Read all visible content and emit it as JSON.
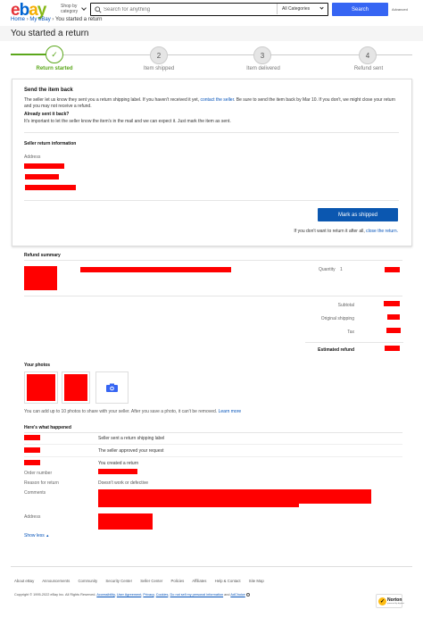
{
  "header": {
    "logo_letters": [
      "e",
      "b",
      "a",
      "y"
    ],
    "logo_colors": [
      "#e53238",
      "#0064d2",
      "#f5af02",
      "#86b817"
    ],
    "shop_by_line1": "Shop by",
    "shop_by_line2": "category",
    "search_placeholder": "Search for anything",
    "category_select": "All Categories",
    "search_button": "Search",
    "advanced_link": "Advanced"
  },
  "breadcrumb": {
    "items": [
      "Home",
      "My eBay",
      "You started a return"
    ],
    "separator": "›"
  },
  "page_title": "You started a return",
  "progress": {
    "steps": [
      {
        "label": "Return started",
        "number": "",
        "active": true
      },
      {
        "label": "Item shipped",
        "number": "2",
        "active": false
      },
      {
        "label": "Item delivered",
        "number": "3",
        "active": false
      },
      {
        "label": "Refund sent",
        "number": "4",
        "active": false
      }
    ],
    "active_color": "#5ba71b"
  },
  "send_back": {
    "heading": "Send the item back",
    "body_before_link": "The seller let us know they sent you a return shipping label. If you haven't received it yet,",
    "contact_link": "contact the seller",
    "body_after_link": ". Be sure to send the item back by Mar 10. If you don't, we might close your return and you may not receive a refund.",
    "already_sent_heading": "Already sent it back?",
    "already_sent_body": "It's important to let the seller know the item's in the mail and we can expect it. Just mark the item as sent.",
    "seller_info_heading": "Seller return information",
    "address_label": "Address",
    "mark_shipped_button": "Mark as shipped",
    "dont_return_text": "If you don't want to return it after all,",
    "close_return_link": "close the return."
  },
  "refund_summary": {
    "heading": "Refund summary",
    "quantity_label": "Quantity",
    "quantity_value": "1",
    "subtotal_label": "Subtotal",
    "original_shipping_label": "Original shipping",
    "tax_label": "Tax",
    "estimated_refund_label": "Estimated refund"
  },
  "photos": {
    "heading": "Your photos",
    "note": "You can add up to 10 photos to share with your seller. After you save a photo, it can't be removed.",
    "learn_more": "Learn more"
  },
  "history": {
    "heading": "Here's what happened",
    "events": [
      "Seller sent a return shipping label",
      "The seller approved your request",
      "You created a return"
    ],
    "order_number_label": "Order number",
    "reason_label": "Reason for return",
    "reason_value": "Doesn't work or defective",
    "comments_label": "Comments",
    "address_label": "Address",
    "show_less": "Show less"
  },
  "footer": {
    "links": [
      "About eBay",
      "Announcements",
      "Community",
      "Security Center",
      "Seller Center",
      "Policies",
      "Affiliates",
      "Help & Contact",
      "Site Map"
    ],
    "copyright": "Copyright © 1995-2022 eBay Inc. All Rights Reserved.",
    "legal_links": [
      "Accessibility",
      "User Agreement",
      "Privacy",
      "Cookies",
      "Do not sell my personal information",
      "AdChoice"
    ],
    "legal_and": "and",
    "norton_label": "Norton",
    "norton_sub": "powered by digicert"
  }
}
